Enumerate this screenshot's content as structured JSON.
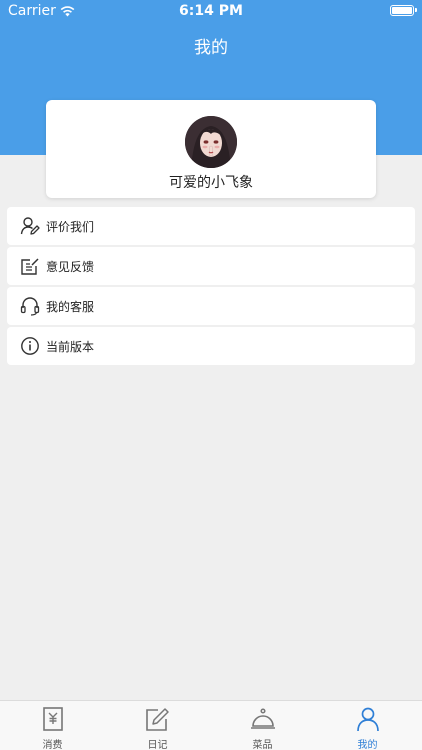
{
  "status_bar": {
    "carrier": "Carrier",
    "time": "6:14 PM"
  },
  "header": {
    "title": "我的"
  },
  "profile": {
    "username": "可爱的小飞象"
  },
  "menu": [
    {
      "label": "评价我们",
      "icon": "user-edit-icon"
    },
    {
      "label": "意见反馈",
      "icon": "feedback-note-icon"
    },
    {
      "label": "我的客服",
      "icon": "headset-icon"
    },
    {
      "label": "当前版本",
      "icon": "info-icon"
    }
  ],
  "tabbar": {
    "tabs": [
      {
        "label": "消费",
        "icon": "receipt-icon",
        "active": false
      },
      {
        "label": "日记",
        "icon": "note-edit-icon",
        "active": false
      },
      {
        "label": "菜品",
        "icon": "food-cloche-icon",
        "active": false
      },
      {
        "label": "我的",
        "icon": "person-icon",
        "active": true
      }
    ]
  },
  "colors": {
    "header_bg": "#4a9ee8",
    "active_tab": "#2f7fd6",
    "page_bg": "#efefef"
  }
}
